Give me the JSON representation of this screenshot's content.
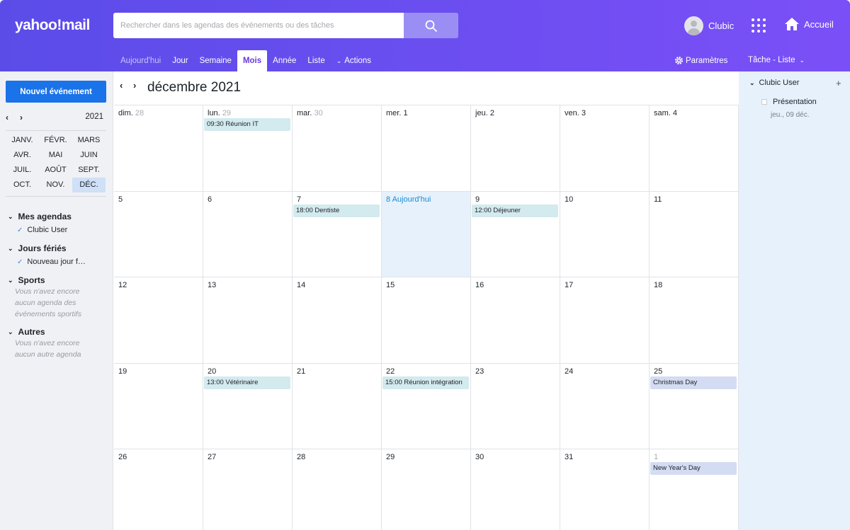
{
  "header": {
    "logo": "yahoo!mail",
    "search_placeholder": "Rechercher dans les agendas des événements ou des tâches",
    "user_name": "Clubic",
    "home_label": "Accueil"
  },
  "tabs": [
    {
      "label": "Aujourd'hui",
      "dim": true
    },
    {
      "label": "Jour"
    },
    {
      "label": "Semaine"
    },
    {
      "label": "Mois",
      "active": true
    },
    {
      "label": "Année"
    },
    {
      "label": "Liste"
    },
    {
      "label": "Actions",
      "chevron": true
    }
  ],
  "toolbar": {
    "settings_label": "Paramètres",
    "tasklist_label": "Tâche - Liste"
  },
  "sidebar": {
    "new_event_label": "Nouvel événement",
    "mini_year": "2021",
    "months": [
      "JANV.",
      "FÉVR.",
      "MARS",
      "AVR.",
      "MAI",
      "JUIN",
      "JUIL.",
      "AOÛT",
      "SEPT.",
      "OCT.",
      "NOV.",
      "DÉC."
    ],
    "selected_month": "DÉC.",
    "sections": {
      "mes_agendas": "Mes agendas",
      "mes_agendas_item": "Clubic User",
      "jours_feries": "Jours fériés",
      "jours_feries_item": "Nouveau jour f…",
      "sports": "Sports",
      "sports_note": "Vous n'avez encore aucun agenda des événements sportifs",
      "autres": "Autres",
      "autres_note": "Vous n'avez encore aucun autre agenda"
    }
  },
  "calendar": {
    "title": "décembre 2021",
    "weeks": [
      [
        {
          "prefix": "dim.",
          "day": "28",
          "muted": true
        },
        {
          "prefix": "lun.",
          "day": "29",
          "muted": true,
          "events": [
            {
              "text": "09:30 Réunion IT",
              "kind": "teal"
            }
          ]
        },
        {
          "prefix": "mar.",
          "day": "30",
          "muted": true
        },
        {
          "prefix": "mer.",
          "day": "1"
        },
        {
          "prefix": "jeu.",
          "day": "2"
        },
        {
          "prefix": "ven.",
          "day": "3"
        },
        {
          "prefix": "sam.",
          "day": "4"
        }
      ],
      [
        {
          "day": "5"
        },
        {
          "day": "6"
        },
        {
          "day": "7",
          "events": [
            {
              "text": "18:00 Dentiste",
              "kind": "teal"
            }
          ]
        },
        {
          "day": "8 Aujourd'hui",
          "today": true
        },
        {
          "day": "9",
          "events": [
            {
              "text": "12:00 Déjeuner",
              "kind": "teal"
            }
          ]
        },
        {
          "day": "10"
        },
        {
          "day": "11"
        }
      ],
      [
        {
          "day": "12"
        },
        {
          "day": "13"
        },
        {
          "day": "14"
        },
        {
          "day": "15"
        },
        {
          "day": "16"
        },
        {
          "day": "17"
        },
        {
          "day": "18"
        }
      ],
      [
        {
          "day": "19"
        },
        {
          "day": "20",
          "events": [
            {
              "text": "13:00 Vétérinaire",
              "kind": "teal"
            }
          ]
        },
        {
          "day": "21"
        },
        {
          "day": "22",
          "events": [
            {
              "text": "15:00 Réunion intégration",
              "kind": "teal"
            }
          ]
        },
        {
          "day": "23"
        },
        {
          "day": "24"
        },
        {
          "day": "25",
          "events": [
            {
              "text": "Christmas Day",
              "kind": "holiday"
            }
          ]
        }
      ],
      [
        {
          "day": "26"
        },
        {
          "day": "27"
        },
        {
          "day": "28"
        },
        {
          "day": "29"
        },
        {
          "day": "30"
        },
        {
          "day": "31"
        },
        {
          "day": "1",
          "muted_all": true,
          "events": [
            {
              "text": "New Year's Day",
              "kind": "holiday"
            }
          ]
        }
      ]
    ]
  },
  "tasks": {
    "owner": "Clubic User",
    "add_symbol": "+",
    "items": [
      {
        "title": "Présentation",
        "date": "jeu., 09 déc."
      }
    ]
  },
  "colors": {
    "accent": "#6639e0",
    "primary_button": "#1a73e8",
    "today_bg": "#e6f1fb",
    "event_bg": "#d3eaee",
    "holiday_bg": "#d3dcf2"
  }
}
